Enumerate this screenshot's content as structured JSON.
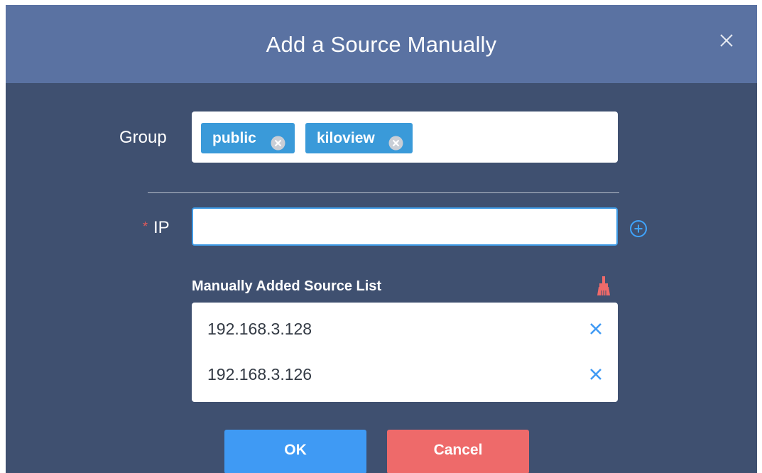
{
  "dialog": {
    "title": "Add a Source Manually",
    "close_icon": "close-icon"
  },
  "group": {
    "label": "Group",
    "tags": [
      {
        "label": "public",
        "remove_icon": "circle-x-icon"
      },
      {
        "label": "kiloview",
        "remove_icon": "circle-x-icon"
      }
    ]
  },
  "ip": {
    "required_mark": "*",
    "label": "IP",
    "value": "",
    "placeholder": "",
    "add_icon": "plus-circle-icon"
  },
  "source_list": {
    "label": "Manually Added Source List",
    "clear_icon": "broom-icon",
    "items": [
      {
        "ip": "192.168.3.128",
        "remove_icon": "x-icon"
      },
      {
        "ip": "192.168.3.126",
        "remove_icon": "x-icon"
      }
    ]
  },
  "buttons": {
    "ok": "OK",
    "cancel": "Cancel"
  },
  "colors": {
    "header_bg": "#5a72a2",
    "body_bg": "#3f5070",
    "tag_bg": "#3a9ad9",
    "accent_blue": "#3f9af4",
    "danger_red": "#ee6a6a"
  }
}
